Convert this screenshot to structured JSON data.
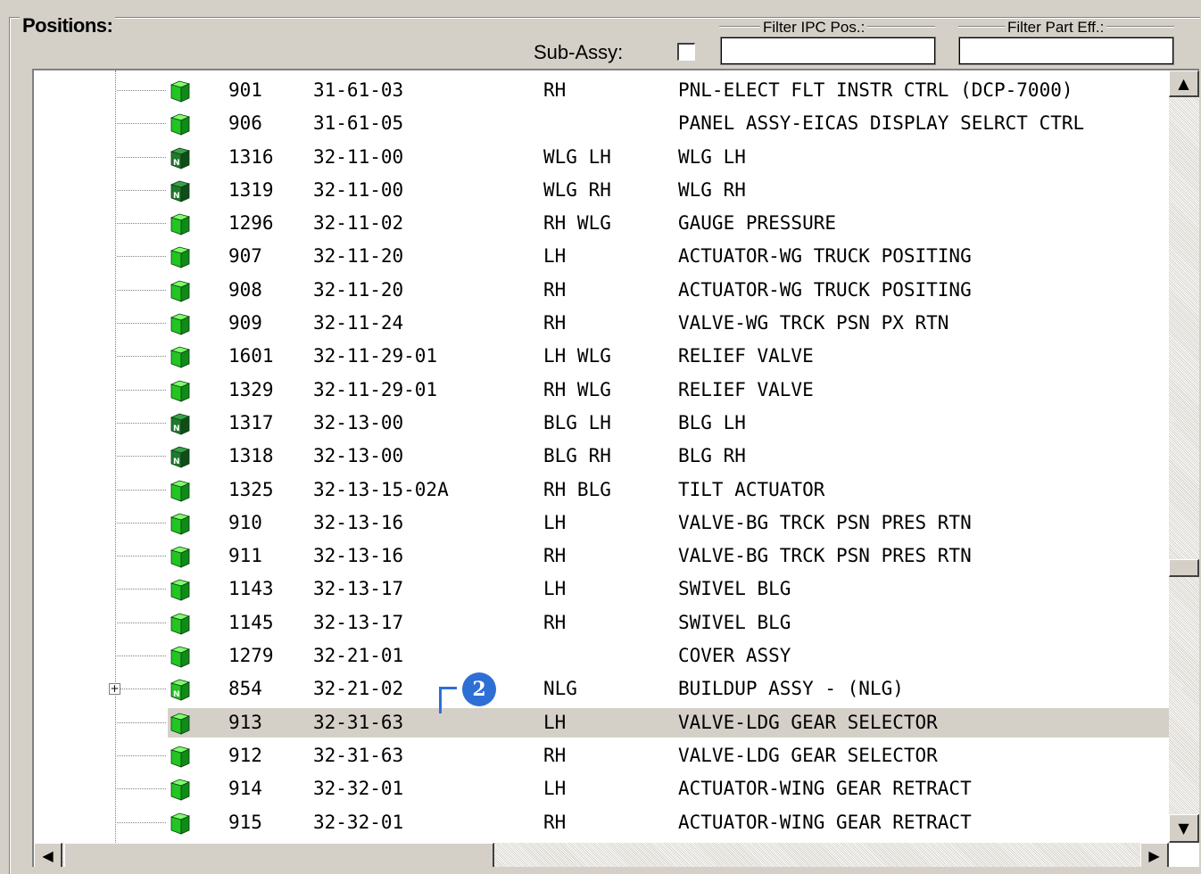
{
  "panel": {
    "title": "Positions:",
    "filter_ipc_label": "Filter IPC Pos.:",
    "filter_part_eff_label": "Filter Part Eff.:",
    "sub_assy_label": "Sub-Assy:",
    "sub_assy_checked": false,
    "filter_ipc_value": "",
    "filter_part_eff_value": ""
  },
  "rows": [
    {
      "pos": "901",
      "ipc": "31-61-03",
      "eff": "RH",
      "desc": "PNL-ELECT FLT INSTR CTRL (DCP-7000)",
      "icon": "green-cube-icon"
    },
    {
      "pos": "906",
      "ipc": "31-61-05",
      "eff": "",
      "desc": "PANEL ASSY-EICAS DISPLAY SELRCT CTRL",
      "icon": "green-cube-icon"
    },
    {
      "pos": "1316",
      "ipc": "32-11-00",
      "eff": "WLG LH",
      "desc": "WLG LH",
      "icon": "dark-green-n-cube-icon"
    },
    {
      "pos": "1319",
      "ipc": "32-11-00",
      "eff": "WLG RH",
      "desc": "WLG RH",
      "icon": "dark-green-n-cube-icon"
    },
    {
      "pos": "1296",
      "ipc": "32-11-02",
      "eff": "RH WLG",
      "desc": "GAUGE PRESSURE",
      "icon": "green-cube-icon"
    },
    {
      "pos": "907",
      "ipc": "32-11-20",
      "eff": "LH",
      "desc": "ACTUATOR-WG TRUCK POSITING",
      "icon": "green-cube-icon"
    },
    {
      "pos": "908",
      "ipc": "32-11-20",
      "eff": "RH",
      "desc": "ACTUATOR-WG TRUCK POSITING",
      "icon": "green-cube-icon"
    },
    {
      "pos": "909",
      "ipc": "32-11-24",
      "eff": "RH",
      "desc": "VALVE-WG TRCK PSN PX RTN",
      "icon": "green-cube-icon"
    },
    {
      "pos": "1601",
      "ipc": "32-11-29-01",
      "eff": "LH WLG",
      "desc": "RELIEF VALVE",
      "icon": "green-cube-icon"
    },
    {
      "pos": "1329",
      "ipc": "32-11-29-01",
      "eff": "RH WLG",
      "desc": "RELIEF VALVE",
      "icon": "green-cube-icon"
    },
    {
      "pos": "1317",
      "ipc": "32-13-00",
      "eff": "BLG LH",
      "desc": "BLG LH",
      "icon": "dark-green-n-cube-icon"
    },
    {
      "pos": "1318",
      "ipc": "32-13-00",
      "eff": "BLG RH",
      "desc": "BLG RH",
      "icon": "dark-green-n-cube-icon"
    },
    {
      "pos": "1325",
      "ipc": "32-13-15-02A",
      "eff": "RH BLG",
      "desc": "TILT ACTUATOR",
      "icon": "green-cube-icon"
    },
    {
      "pos": "910",
      "ipc": "32-13-16",
      "eff": "LH",
      "desc": "VALVE-BG TRCK PSN PRES RTN",
      "icon": "green-cube-icon"
    },
    {
      "pos": "911",
      "ipc": "32-13-16",
      "eff": "RH",
      "desc": "VALVE-BG TRCK PSN PRES RTN",
      "icon": "green-cube-icon"
    },
    {
      "pos": "1143",
      "ipc": "32-13-17",
      "eff": "LH",
      "desc": "SWIVEL BLG",
      "icon": "green-cube-icon"
    },
    {
      "pos": "1145",
      "ipc": "32-13-17",
      "eff": "RH",
      "desc": "SWIVEL BLG",
      "icon": "green-cube-icon"
    },
    {
      "pos": "1279",
      "ipc": "32-21-01",
      "eff": "",
      "desc": "COVER ASSY",
      "icon": "green-cube-icon"
    },
    {
      "pos": "854",
      "ipc": "32-21-02",
      "eff": "NLG",
      "desc": "BUILDUP ASSY - (NLG)",
      "icon": "green-n-cube-icon",
      "expandable": true
    },
    {
      "pos": "913",
      "ipc": "32-31-63",
      "eff": "LH",
      "desc": "VALVE-LDG GEAR SELECTOR",
      "icon": "green-cube-icon",
      "selected": true
    },
    {
      "pos": "912",
      "ipc": "32-31-63",
      "eff": "RH",
      "desc": "VALVE-LDG GEAR SELECTOR",
      "icon": "green-cube-icon"
    },
    {
      "pos": "914",
      "ipc": "32-32-01",
      "eff": "LH",
      "desc": "ACTUATOR-WING GEAR RETRACT",
      "icon": "green-cube-icon"
    },
    {
      "pos": "915",
      "ipc": "32-32-01",
      "eff": "RH",
      "desc": "ACTUATOR-WING GEAR RETRACT",
      "icon": "green-cube-icon"
    }
  ],
  "callout": {
    "label": "2",
    "color": "#2e6fd6"
  },
  "colors": {
    "selection": "#d4d0c8",
    "cube_green": "#2fc52f",
    "cube_dark": "#1d7a2a"
  },
  "icons": {
    "expand": "+",
    "scroll_up": "▲",
    "scroll_down": "▼",
    "scroll_left": "◀",
    "scroll_right": "▶"
  }
}
